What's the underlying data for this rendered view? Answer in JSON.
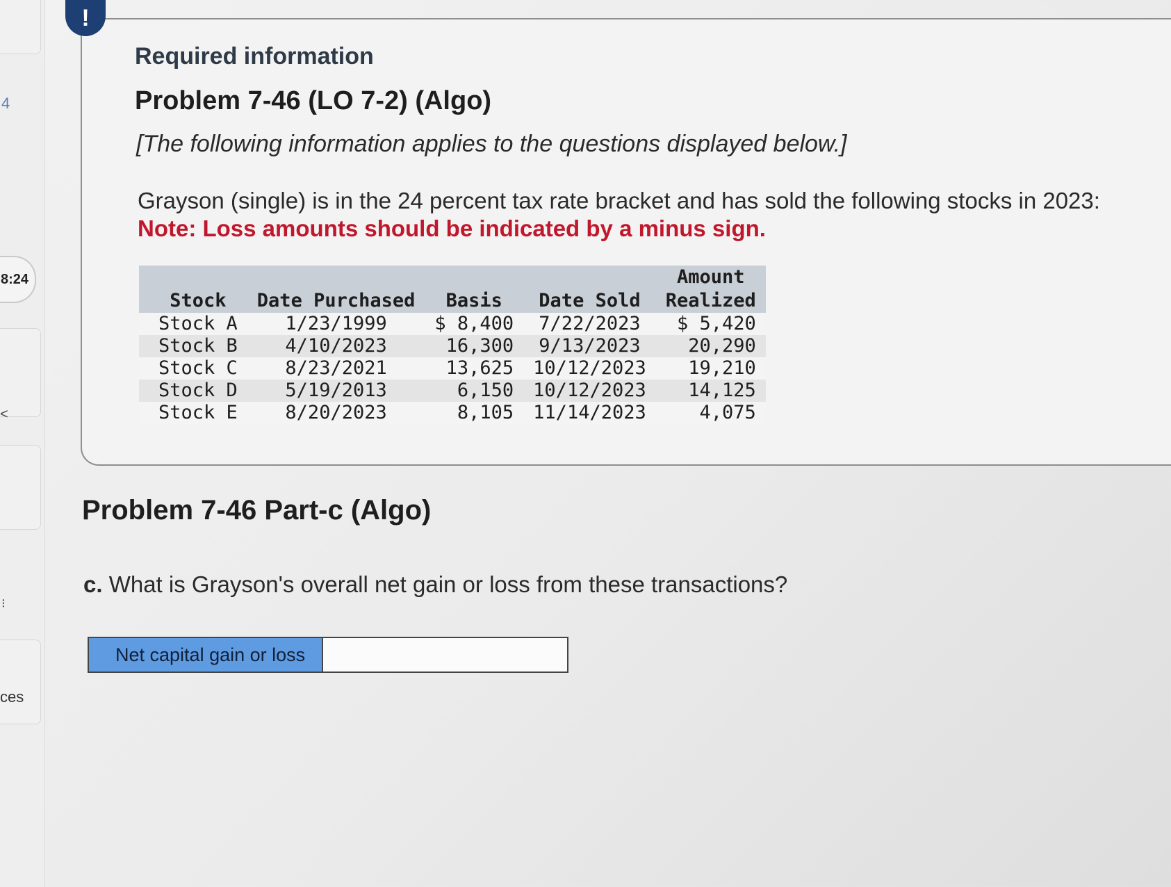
{
  "sidebar": {
    "question_number": "4",
    "timer": "8:24",
    "nav_arrow": "<",
    "item_label": "ces"
  },
  "info": {
    "alert_symbol": "!",
    "required_label": "Required information",
    "problem_title": "Problem 7-46 (LO 7-2) (Algo)",
    "applies_text": "[The following information applies to the questions displayed below.]",
    "intro_text": "Grayson (single) is in the 24 percent tax rate bracket and has sold the following stocks in 2023:",
    "note_text": "Note: Loss amounts should be indicated by a minus sign."
  },
  "table": {
    "headers": [
      "Stock",
      "Date Purchased",
      "Basis",
      "Date Sold",
      "Amount Realized"
    ],
    "rows": [
      [
        "Stock A",
        "1/23/1999",
        "$ 8,400",
        "7/22/2023",
        "$ 5,420"
      ],
      [
        "Stock B",
        "4/10/2023",
        "16,300",
        "9/13/2023",
        "20,290"
      ],
      [
        "Stock C",
        "8/23/2021",
        "13,625",
        "10/12/2023",
        "19,210"
      ],
      [
        "Stock D",
        "5/19/2013",
        "6,150",
        "10/12/2023",
        "14,125"
      ],
      [
        "Stock E",
        "8/20/2023",
        "8,105",
        "11/14/2023",
        "4,075"
      ]
    ]
  },
  "part": {
    "title": "Problem 7-46 Part-c (Algo)",
    "question_prefix": "c.",
    "question_text": "What is Grayson's overall net gain or loss from these transactions?"
  },
  "answer": {
    "label": "Net capital gain or loss",
    "value": ""
  },
  "colors": {
    "alert_badge": "#1e3f73",
    "note_red": "#c0172c",
    "answer_label_bg": "#5f9be0",
    "table_header_bg": "#c9cfd6"
  }
}
